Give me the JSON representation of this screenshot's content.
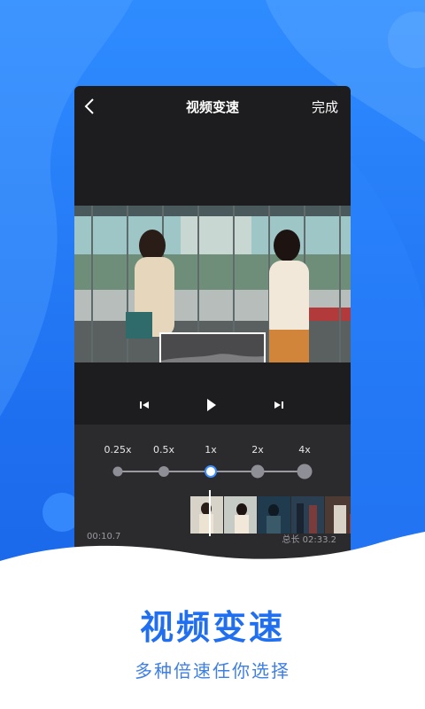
{
  "header": {
    "title": "视频变速",
    "done_label": "完成",
    "back_icon": "chevron-left-icon"
  },
  "player": {
    "prev_icon": "skip-previous-icon",
    "play_icon": "play-icon",
    "next_icon": "skip-next-icon"
  },
  "speed": {
    "options": [
      "0.25x",
      "0.5x",
      "1x",
      "2x",
      "4x"
    ],
    "selected": "1x"
  },
  "timeline": {
    "current_time": "00:10.7",
    "total_time": "总长 02:33.2"
  },
  "promo": {
    "headline": "视频变速",
    "subline": "多种倍速任你选择"
  },
  "colors": {
    "brand_blue": "#1f6ff0",
    "panel_bg": "#2b2b2e",
    "phone_bg": "#1d1d1f"
  }
}
